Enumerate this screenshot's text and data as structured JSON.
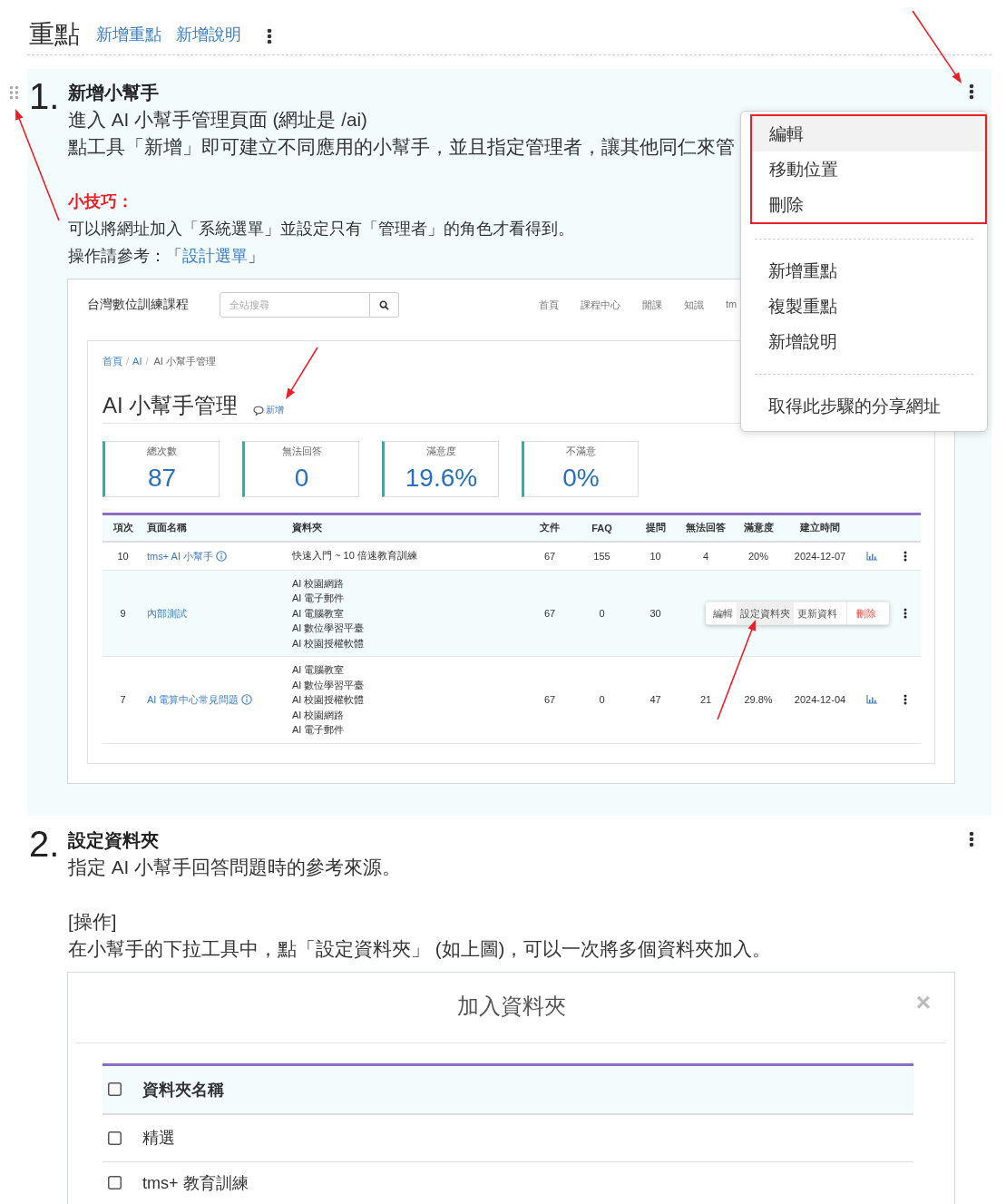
{
  "header": {
    "title": "重點",
    "links": [
      "新增重點",
      "新增說明"
    ]
  },
  "steps": [
    {
      "number": "1.",
      "title": "新增小幫手",
      "highlighted": true,
      "blocks": [
        {
          "kind": "paragraph",
          "lines": [
            "進入 AI 小幫手管理頁面 (網址是 /ai)",
            "點工具「新增」即可建立不同應用的小幫手，並且指定管理者，讓其他同仁來管"
          ]
        },
        {
          "kind": "tip",
          "label": "小技巧：",
          "text": "可以將網址加入「系統選單」並設定只有「管理者」的角色才看得到。",
          "reference": {
            "prefix": "操作請參考：「",
            "link": "設計選單",
            "suffix": "」"
          }
        },
        {
          "kind": "admin_screenshot",
          "site_title": "台灣數位訓練課程",
          "search": {
            "placeholder": "全站搜尋"
          },
          "nav": [
            "首頁",
            "課程中心",
            "開課",
            "知識",
            "tm"
          ],
          "breadcrumb": {
            "separator": "/",
            "items": [
              "首頁",
              "AI",
              "AI 小幫手管理"
            ]
          },
          "page_title": "AI 小幫手管理",
          "add_link": "新增",
          "stats": [
            {
              "label": "總次數",
              "value": "87"
            },
            {
              "label": "無法回答",
              "value": "0"
            },
            {
              "label": "滿意度",
              "value": "19.6%"
            },
            {
              "label": "不滿意",
              "value": "0%"
            }
          ],
          "columns": [
            "項次",
            "頁面名稱",
            "資料夾",
            "文件",
            "FAQ",
            "提問",
            "無法回答",
            "滿意度",
            "建立時間"
          ],
          "rows": [
            {
              "index": "10",
              "name": "tms+ AI 小幫手",
              "info": true,
              "folders": [
                "快速入門 ~ 10 倍速教育訓練"
              ],
              "documents": "67",
              "faq": "155",
              "questions": "10",
              "unanswered": "4",
              "satisfaction": "20%",
              "created": "2024-12-07",
              "selected": false
            },
            {
              "index": "9",
              "name": "內部測試",
              "info": false,
              "folders": [
                "AI 校園網路",
                "AI 電子郵件",
                "AI 電腦教室",
                "AI 數位學習平臺",
                "AI 校園授權軟體"
              ],
              "documents": "67",
              "faq": "0",
              "questions": "30",
              "selected": true,
              "actions": [
                {
                  "label": "編輯",
                  "kind": "normal",
                  "selected": false
                },
                {
                  "label": "設定資料夾",
                  "kind": "normal",
                  "selected": true
                },
                {
                  "label": "更新資料",
                  "kind": "normal",
                  "selected": false
                },
                {
                  "label": "刪除",
                  "kind": "danger",
                  "selected": false
                }
              ]
            },
            {
              "index": "7",
              "name": "AI 電算中心常見問題",
              "info": true,
              "folders": [
                "AI 電腦教室",
                "AI 數位學習平臺",
                "AI 校園授權軟體",
                "AI 校園網路",
                "AI 電子郵件"
              ],
              "documents": "67",
              "faq": "0",
              "questions": "47",
              "unanswered": "21",
              "satisfaction": "29.8%",
              "created": "2024-12-04",
              "selected": false
            }
          ]
        }
      ],
      "menu": {
        "groups": [
          {
            "outlined": true,
            "items": [
              {
                "label": "編輯",
                "selected": true
              },
              {
                "label": "移動位置",
                "selected": false
              },
              {
                "label": "刪除",
                "selected": false
              }
            ]
          },
          {
            "outlined": false,
            "items": [
              {
                "label": "新增重點",
                "selected": false
              },
              {
                "label": "複製重點",
                "selected": false
              },
              {
                "label": "新增說明",
                "selected": false
              }
            ]
          },
          {
            "outlined": false,
            "items": [
              {
                "label": "取得此步驟的分享網址",
                "selected": false
              }
            ]
          }
        ]
      }
    },
    {
      "number": "2.",
      "title": "設定資料夾",
      "highlighted": false,
      "blocks": [
        {
          "kind": "paragraph",
          "lines": [
            "指定 AI 小幫手回答問題時的參考來源。"
          ]
        },
        {
          "kind": "paragraph",
          "lines": [
            "[操作]",
            "在小幫手的下拉工具中，點「設定資料夾」 (如上圖)，可以一次將多個資料夾加入。"
          ]
        },
        {
          "kind": "modal_screenshot",
          "title": "加入資料夾",
          "close": "×",
          "header": {
            "label": "資料夾名稱",
            "checked": false
          },
          "rows": [
            {
              "label": "精選",
              "checked": false
            },
            {
              "label": "tms+ 教育訓練",
              "checked": false
            }
          ]
        }
      ]
    }
  ]
}
